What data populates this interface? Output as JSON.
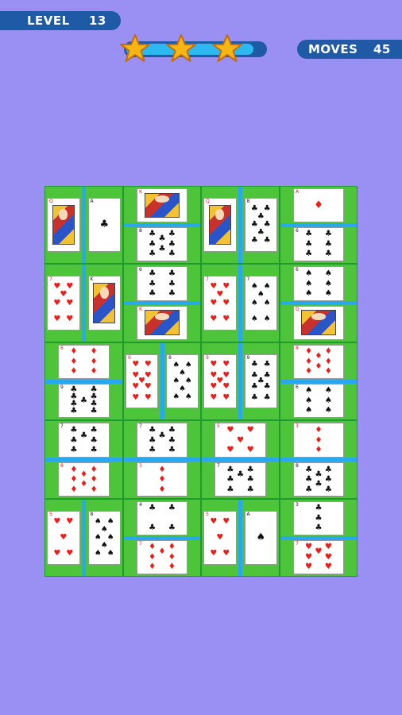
{
  "hud": {
    "level_label": "LEVEL",
    "level_value": "13",
    "moves_label": "MOVES",
    "moves_value": "45",
    "stars_earned": 3,
    "stars_total": 3,
    "progress_fraction": 0.92
  },
  "colors": {
    "background": "#9a8ff3",
    "pill": "#1f5aa6",
    "board_green": "#4ec43a",
    "divider_blue": "#27a8f0",
    "red_suit": "#e8201c",
    "black_suit": "#111111"
  },
  "board": {
    "rows": 5,
    "cols": 4,
    "tiles": [
      {
        "split": "v",
        "cards": [
          {
            "rank": "Q",
            "suit": "diamonds"
          },
          {
            "rank": "A",
            "suit": "clubs"
          }
        ]
      },
      {
        "split": "h",
        "cards": [
          {
            "rank": "K",
            "suit": "diamonds"
          },
          {
            "rank": "8",
            "suit": "clubs"
          }
        ]
      },
      {
        "split": "v",
        "cards": [
          {
            "rank": "Q",
            "suit": "diamonds"
          },
          {
            "rank": "8",
            "suit": "clubs"
          }
        ]
      },
      {
        "split": "h",
        "cards": [
          {
            "rank": "A",
            "suit": "diamonds"
          },
          {
            "rank": "6",
            "suit": "clubs"
          }
        ]
      },
      {
        "split": "v",
        "cards": [
          {
            "rank": "7",
            "suit": "hearts"
          },
          {
            "rank": "K",
            "suit": "clubs"
          }
        ]
      },
      {
        "split": "h",
        "cards": [
          {
            "rank": "6",
            "suit": "clubs"
          },
          {
            "rank": "K",
            "suit": "hearts"
          }
        ]
      },
      {
        "split": "v",
        "cards": [
          {
            "rank": "7",
            "suit": "hearts"
          },
          {
            "rank": "7",
            "suit": "spades"
          }
        ]
      },
      {
        "split": "h",
        "cards": [
          {
            "rank": "6",
            "suit": "spades"
          },
          {
            "rank": "Q",
            "suit": "diamonds"
          }
        ]
      },
      {
        "split": "h",
        "cards": [
          {
            "rank": "6",
            "suit": "diamonds"
          },
          {
            "rank": "9",
            "suit": "clubs"
          }
        ]
      },
      {
        "split": "v",
        "cards": [
          {
            "rank": "9",
            "suit": "hearts"
          },
          {
            "rank": "8",
            "suit": "spades"
          }
        ]
      },
      {
        "split": "v",
        "cards": [
          {
            "rank": "9",
            "suit": "hearts"
          },
          {
            "rank": "9",
            "suit": "clubs"
          }
        ]
      },
      {
        "split": "h",
        "cards": [
          {
            "rank": "8",
            "suit": "diamonds"
          },
          {
            "rank": "6",
            "suit": "spades"
          }
        ]
      },
      {
        "split": "h",
        "cards": [
          {
            "rank": "7",
            "suit": "clubs"
          },
          {
            "rank": "8",
            "suit": "diamonds"
          }
        ]
      },
      {
        "split": "h",
        "cards": [
          {
            "rank": "7",
            "suit": "clubs"
          },
          {
            "rank": "3",
            "suit": "diamonds"
          }
        ]
      },
      {
        "split": "h",
        "cards": [
          {
            "rank": "5",
            "suit": "hearts"
          },
          {
            "rank": "7",
            "suit": "clubs"
          }
        ]
      },
      {
        "split": "h",
        "cards": [
          {
            "rank": "3",
            "suit": "diamonds"
          },
          {
            "rank": "8",
            "suit": "clubs"
          }
        ]
      },
      {
        "split": "v",
        "cards": [
          {
            "rank": "5",
            "suit": "hearts"
          },
          {
            "rank": "8",
            "suit": "spades"
          }
        ]
      },
      {
        "split": "h",
        "cards": [
          {
            "rank": "4",
            "suit": "clubs"
          },
          {
            "rank": "7",
            "suit": "diamonds"
          }
        ]
      },
      {
        "split": "v",
        "cards": [
          {
            "rank": "5",
            "suit": "hearts"
          },
          {
            "rank": "A",
            "suit": "spades"
          }
        ]
      },
      {
        "split": "h",
        "cards": [
          {
            "rank": "3",
            "suit": "clubs"
          },
          {
            "rank": "7",
            "suit": "hearts"
          }
        ]
      }
    ]
  }
}
